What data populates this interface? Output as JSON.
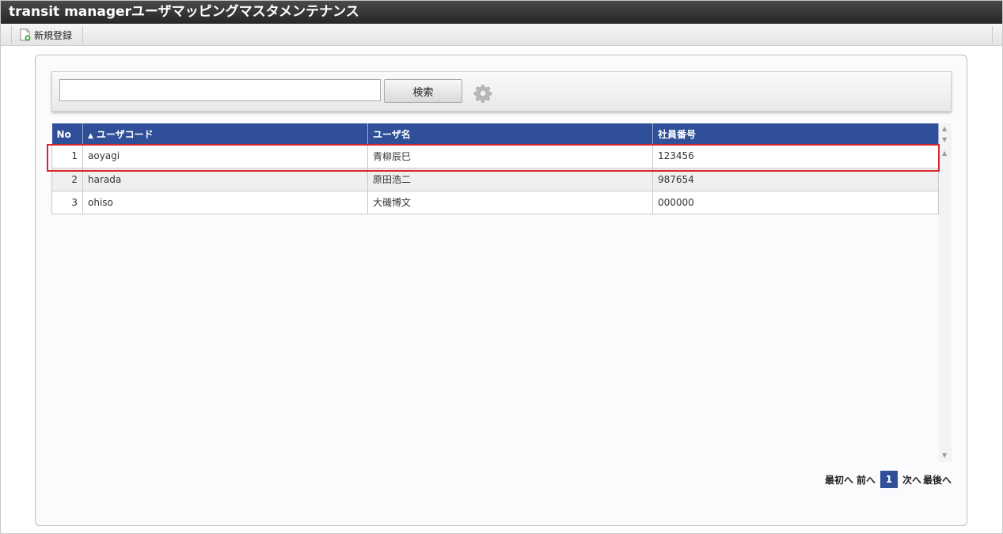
{
  "window": {
    "title": "transit managerユーザマッピングマスタメンテナンス"
  },
  "toolbar": {
    "new_label": "新規登録",
    "new_icon": "new-document-icon"
  },
  "search": {
    "value": "",
    "placeholder": "",
    "button_label": "検索",
    "settings_icon": "gear-icon"
  },
  "table": {
    "columns": [
      {
        "label": "No"
      },
      {
        "label": "ユーザコード",
        "sort": "ascending",
        "sort_glyph": "▲"
      },
      {
        "label": "ユーザ名"
      },
      {
        "label": "社員番号"
      }
    ],
    "rows": [
      {
        "no": "1",
        "code": "aoyagi",
        "name": "青柳辰巳",
        "emp": "123456",
        "highlighted": true
      },
      {
        "no": "2",
        "code": "harada",
        "name": "原田浩二",
        "emp": "987654"
      },
      {
        "no": "3",
        "code": "ohiso",
        "name": "大磯博文",
        "emp": "000000"
      }
    ]
  },
  "pager": {
    "first": "最初へ",
    "prev": "前へ",
    "current": "1",
    "next": "次へ",
    "last": "最後へ"
  },
  "colors": {
    "header_bg": "#2f4f99",
    "highlight": "#d8262f",
    "titlebar": "#333333"
  }
}
